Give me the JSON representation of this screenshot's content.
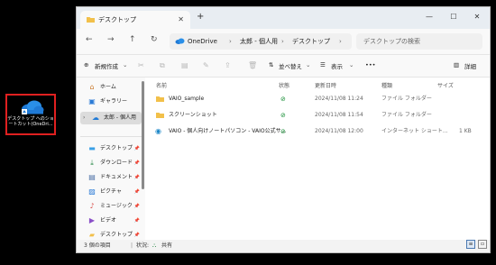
{
  "desktop": {
    "icon_label": "デスクトップ へのショートカット(OneDri..."
  },
  "window": {
    "tab_title": "デスクトップ",
    "new_tab": "+",
    "controls": {
      "minimize": "—",
      "maximize": "☐",
      "close": "✕"
    }
  },
  "address": {
    "onedrive": "OneDrive",
    "crumb1": "太郎 - 個人用",
    "crumb2": "デスクトップ",
    "search_placeholder": "デスクトップの検索"
  },
  "toolbar": {
    "new": "新規作成",
    "sort": "並べ替え",
    "view": "表示",
    "more": "•••",
    "details": "詳細"
  },
  "sidebar": {
    "items": [
      {
        "label": "ホーム",
        "icon": "home-icon"
      },
      {
        "label": "ギャラリー",
        "icon": "gallery-icon"
      },
      {
        "label": "太郎 - 個人用",
        "icon": "onedrive-icon"
      },
      {
        "label": "デスクトップ",
        "icon": "desktop-icon"
      },
      {
        "label": "ダウンロード",
        "icon": "download-icon"
      },
      {
        "label": "ドキュメント",
        "icon": "documents-icon"
      },
      {
        "label": "ピクチャ",
        "icon": "pictures-icon"
      },
      {
        "label": "ミュージック",
        "icon": "music-icon"
      },
      {
        "label": "ビデオ",
        "icon": "video-icon"
      },
      {
        "label": "デスクトップ",
        "icon": "desktop-folder-icon"
      }
    ]
  },
  "columns": {
    "name": "名前",
    "status": "状態",
    "date": "更新日時",
    "type": "種類",
    "size": "サイズ"
  },
  "files": [
    {
      "name": "VAIO_sample",
      "date": "2024/11/08 11:24",
      "type": "ファイル フォルダー",
      "size": ""
    },
    {
      "name": "スクリーンショット",
      "date": "2024/11/08 11:54",
      "type": "ファイル フォルダー",
      "size": ""
    },
    {
      "name": "VAIO - 個人向けノートパソコン - VAIO公式サ...",
      "date": "2024/11/08 12:00",
      "type": "インターネット ショート...",
      "size": "1 KB"
    }
  ],
  "statusbar": {
    "count": "3 個の項目",
    "state_label": "状況:",
    "shared": "共有"
  }
}
